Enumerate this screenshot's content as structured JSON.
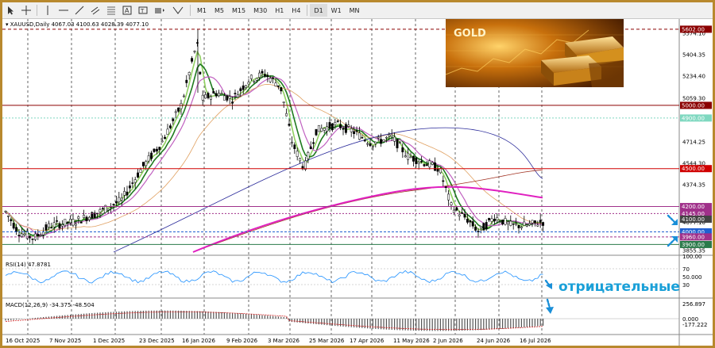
{
  "toolbar": {
    "timeframes": [
      "M1",
      "M5",
      "M15",
      "M30",
      "H1",
      "H4",
      "D1",
      "W1",
      "MN"
    ],
    "active_timeframe": "D1"
  },
  "chart": {
    "symbol_line": "XAUUSD,Daily  4067.03 4100.63 4028.39 4077.10",
    "rsi_label": "RSI(14) 47.8781",
    "macd_label": "MACD(12,26,9) -34.375 -48.504",
    "banner_text": "GOLD",
    "annotation": "отрицательные",
    "price_axis": [
      "5602.00",
      "5574.10",
      "5404.35",
      "5234.40",
      "5059.30",
      "4900.00",
      "4714.25",
      "4544.30",
      "4374.35",
      "4200.00",
      "4145.00",
      "4100.00",
      "4077.10",
      "4000.00",
      "3960.00",
      "3900.00",
      "3855.35"
    ],
    "rsi_axis": [
      "100.00",
      "70",
      "50.000",
      "30"
    ],
    "macd_axis": [
      "256.897",
      "0.000",
      "-177.222"
    ],
    "price_tags": [
      {
        "label": "5602.00",
        "color": "#8b0000"
      },
      {
        "label": "5000.00",
        "color": "#8b0000"
      },
      {
        "label": "4900.00",
        "color": "#7fd8c0"
      },
      {
        "label": "4500.00",
        "color": "#d00000"
      },
      {
        "label": "4200.00",
        "color": "#a0308a"
      },
      {
        "label": "4145.00",
        "color": "#a0308a"
      },
      {
        "label": "4100.00",
        "color": "#444444"
      },
      {
        "label": "4000.00",
        "color": "#2060d0"
      },
      {
        "label": "3960.00",
        "color": "#a0308a"
      },
      {
        "label": "3900.00",
        "color": "#2a7a4a"
      }
    ],
    "dates": [
      "16 Oct 2025",
      "7 Nov 2025",
      "1 Dec 2025",
      "23 Dec 2025",
      "16 Jan 2026",
      "9 Feb 2026",
      "3 Mar 2026",
      "25 Mar 2026",
      "17 Apr 2026",
      "11 May 2026",
      "2 Jun 2026",
      "24 Jun 2026",
      "16 Jul 2026"
    ]
  }
}
